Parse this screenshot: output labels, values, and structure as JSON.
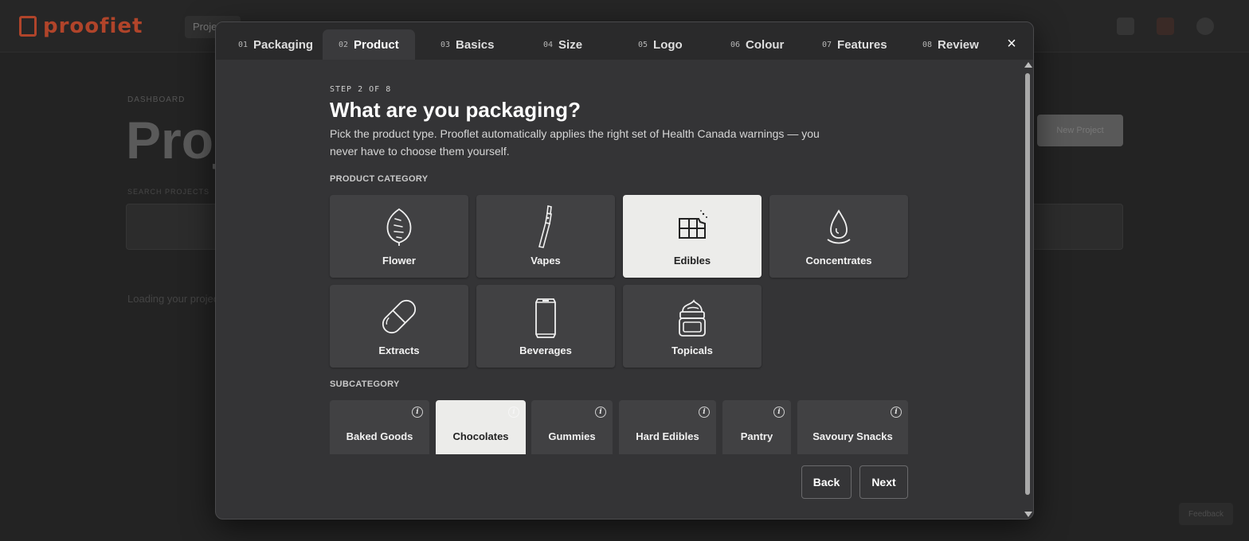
{
  "background": {
    "logo_text": "proofiet",
    "nav_pill": "Projects",
    "breadcrumb": "DASHBOARD",
    "page_title": "Proj",
    "new_project": "New Project",
    "search_label": "SEARCH PROJECTS",
    "loading_text": "Loading your projects...",
    "feedback": "Feedback"
  },
  "tabs": [
    {
      "num": "01",
      "label": "Packaging"
    },
    {
      "num": "02",
      "label": "Product"
    },
    {
      "num": "03",
      "label": "Basics"
    },
    {
      "num": "04",
      "label": "Size"
    },
    {
      "num": "05",
      "label": "Logo"
    },
    {
      "num": "06",
      "label": "Colour"
    },
    {
      "num": "07",
      "label": "Features"
    },
    {
      "num": "08",
      "label": "Review"
    }
  ],
  "active_tab": "Product",
  "close_label": "×",
  "step_label": "STEP 2 OF 8",
  "heading": "What are you packaging?",
  "description": "Pick the product type. Prooflet automatically applies the right set of Health Canada warnings — you never have to choose them yourself.",
  "category_label": "PRODUCT CATEGORY",
  "categories": [
    {
      "label": "Flower",
      "icon": "leaf-icon"
    },
    {
      "label": "Vapes",
      "icon": "vape-pen-icon"
    },
    {
      "label": "Edibles",
      "icon": "chocolate-bar-icon"
    },
    {
      "label": "Concentrates",
      "icon": "droplet-icon"
    },
    {
      "label": "Extracts",
      "icon": "capsule-icon"
    },
    {
      "label": "Beverages",
      "icon": "can-icon"
    },
    {
      "label": "Topicals",
      "icon": "cream-jar-icon"
    }
  ],
  "selected_category": "Edibles",
  "subcategory_label": "SUBCATEGORY",
  "subcategories": [
    {
      "label": "Baked Goods"
    },
    {
      "label": "Chocolates"
    },
    {
      "label": "Gummies"
    },
    {
      "label": "Hard Edibles"
    },
    {
      "label": "Pantry"
    },
    {
      "label": "Savoury Snacks"
    }
  ],
  "selected_subcategory": "Chocolates",
  "info_glyph": "i",
  "buttons": {
    "back": "Back",
    "next": "Next"
  },
  "colors": {
    "modal_bg": "#343436",
    "card_bg": "#414143",
    "selected_bg": "#ececea",
    "brand_accent": "#b0442a"
  }
}
